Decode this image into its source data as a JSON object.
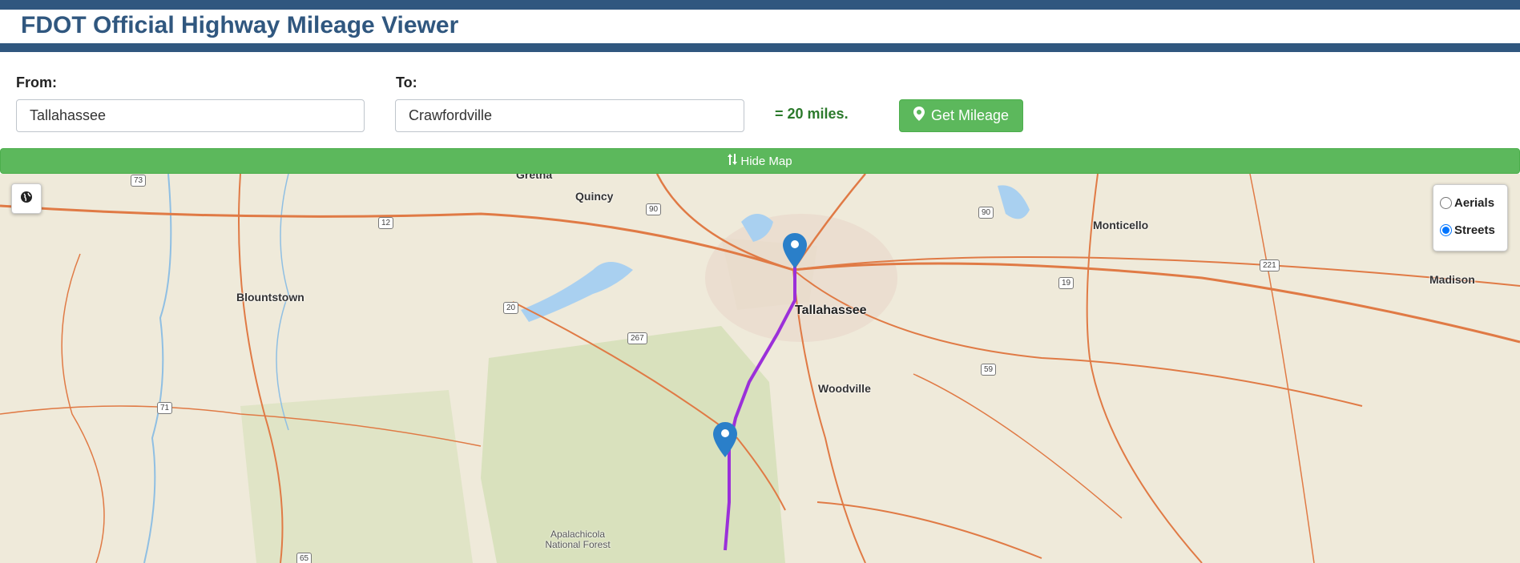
{
  "header": {
    "title": "FDOT Official Highway Mileage Viewer"
  },
  "form": {
    "from_label": "From:",
    "from_value": "Tallahassee",
    "to_label": "To:",
    "to_value": "Crawfordville",
    "result_text": "= 20 miles.",
    "get_mileage_label": "Get Mileage"
  },
  "map_toggle": {
    "label": "Hide Map"
  },
  "map": {
    "layers": [
      {
        "label": "Aerials",
        "selected": false
      },
      {
        "label": "Streets",
        "selected": true
      }
    ],
    "places": {
      "gretna": "Gretna",
      "quincy": "Quincy",
      "monticello": "Monticello",
      "blountstown": "Blountstown",
      "tallahassee": "Tallahassee",
      "madison": "Madison",
      "woodville": "Woodville",
      "apalachicola_forest": "Apalachicola National Forest"
    },
    "shields": [
      "73",
      "90",
      "90",
      "12",
      "221",
      "19",
      "20",
      "267",
      "59",
      "71",
      "65"
    ],
    "route_color": "#9b30d9",
    "pin_color": "#2a7fc9",
    "road_color": "#e07a45",
    "water_color": "#a9d0f0",
    "forest_color": "#d7dfb9"
  },
  "colors": {
    "brand": "#30577f",
    "success": "#5cb85c",
    "result": "#2c7a2c"
  },
  "icons": {
    "get_mileage": "map-marker-icon",
    "hide_map": "sort-arrows-icon",
    "globe": "globe-icon"
  }
}
